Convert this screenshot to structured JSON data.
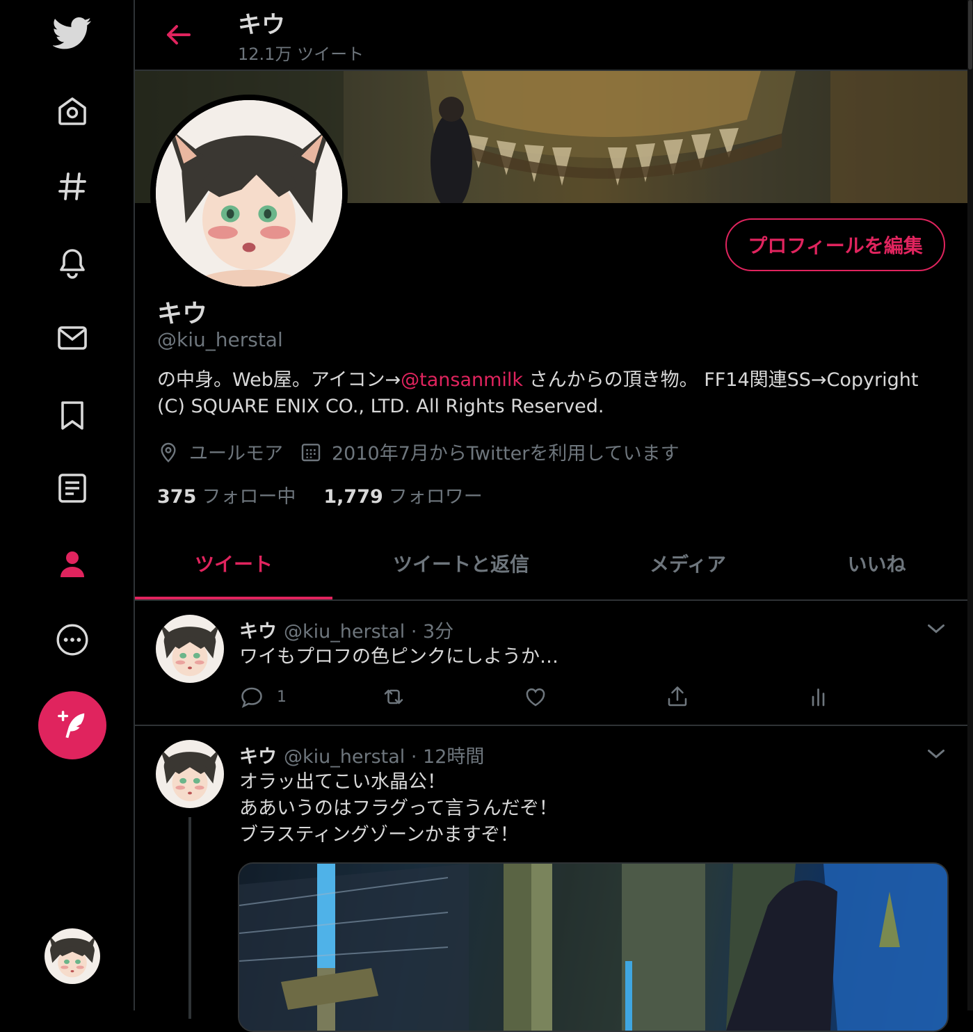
{
  "sidebar": {
    "items": [
      {
        "name": "twitter-logo-icon"
      },
      {
        "name": "home-icon"
      },
      {
        "name": "explore-hash-icon"
      },
      {
        "name": "notifications-bell-icon"
      },
      {
        "name": "messages-envelope-icon"
      },
      {
        "name": "bookmarks-icon"
      },
      {
        "name": "lists-icon"
      },
      {
        "name": "profile-icon",
        "active": true
      },
      {
        "name": "more-icon"
      }
    ],
    "compose_icon": "compose-feather-icon"
  },
  "header": {
    "name": "キウ",
    "tweet_count": "12.1万 ツイート"
  },
  "profile": {
    "edit_button": "プロフィールを編集",
    "name": "キウ",
    "handle": "@kiu_herstal",
    "bio_before": "の中身。Web屋。アイコン→",
    "bio_mention": "@tansanmilk",
    "bio_after": " さんからの頂き物。 FF14関連SS→Copyright (C) SQUARE ENIX CO., LTD. All Rights Reserved.",
    "location": "ユールモア",
    "joined": "2010年7月からTwitterを利用しています",
    "following_count": "375",
    "following_label": "フォロー中",
    "followers_count": "1,779",
    "followers_label": "フォロワー"
  },
  "tabs": [
    {
      "label": "ツイート",
      "active": true
    },
    {
      "label": "ツイートと返信"
    },
    {
      "label": "メディア"
    },
    {
      "label": "いいね"
    }
  ],
  "tweets": [
    {
      "name": "キウ",
      "handle": "@kiu_herstal",
      "time": " · 3分",
      "text": "ワイもプロフの色ピンクにしようか…",
      "reply_count": "1"
    },
    {
      "name": "キウ",
      "handle": "@kiu_herstal",
      "time": " · 12時間",
      "text": "オラッ出てこい水晶公！\nああいうのはフラグって言うんだぞ！\nブラスティングゾーンかますぞ！"
    }
  ],
  "colors": {
    "accent": "#e0245e",
    "background": "#000000",
    "text": "#d9d9d9",
    "muted": "#6e767d",
    "border": "#2f3336"
  }
}
